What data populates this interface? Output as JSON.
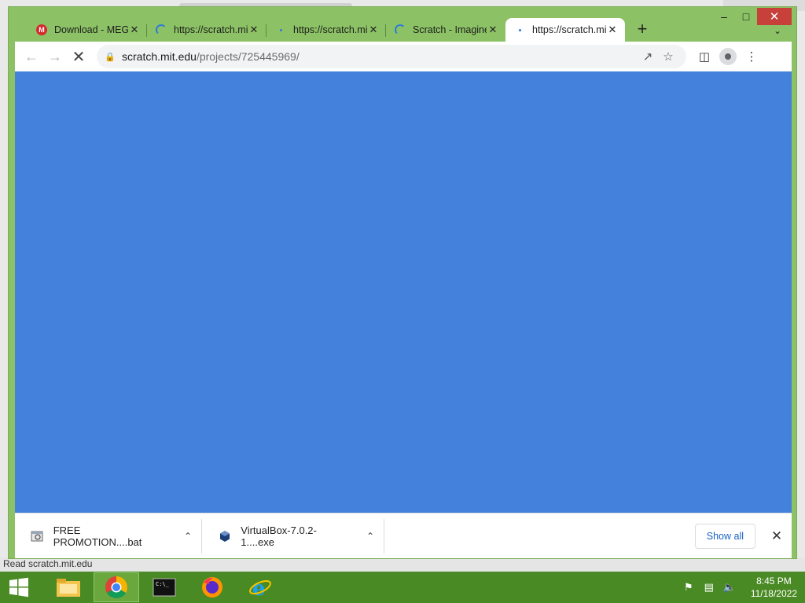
{
  "status_strip": "Read scratch.mit.edu",
  "tabs": [
    {
      "title": "Download - MEGA",
      "favicon": "mega-icon",
      "active": false
    },
    {
      "title": "https://scratch.mit.edu",
      "favicon": "loading-spinner-icon",
      "active": false
    },
    {
      "title": "https://scratch.mit.edu",
      "favicon": "loading-dot-icon",
      "active": false
    },
    {
      "title": "Scratch - Imagine",
      "favicon": "loading-spinner-icon",
      "active": false
    },
    {
      "title": "https://scratch.mit.edu",
      "favicon": "loading-dot-icon",
      "active": true
    }
  ],
  "toolbar": {
    "url_host": "scratch.mit.edu",
    "url_path": "/projects/725445969/"
  },
  "page": {
    "background": "#4381dc"
  },
  "downloads": {
    "items": [
      {
        "name": "FREE PROMOTION....bat",
        "icon": "batch-file-icon"
      },
      {
        "name": "VirtualBox-7.0.2-1....exe",
        "icon": "virtualbox-icon"
      }
    ],
    "show_all_label": "Show all"
  },
  "taskbar": {
    "apps": [
      "file-explorer-icon",
      "chrome-icon",
      "command-prompt-icon",
      "firefox-icon",
      "internet-explorer-icon"
    ],
    "time": "8:45 PM",
    "date": "11/18/2022"
  },
  "colors": {
    "accent": "#8cc265",
    "taskbar": "#4a8a24"
  }
}
